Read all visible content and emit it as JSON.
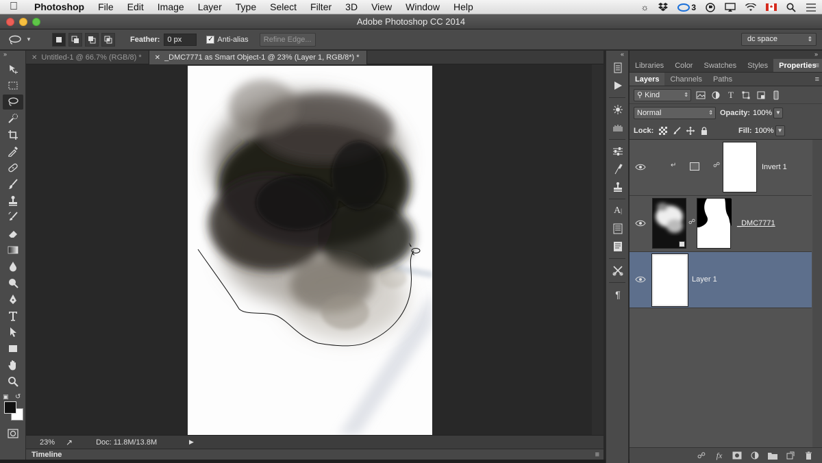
{
  "mac_menubar": {
    "app_name": "Photoshop",
    "items": [
      "File",
      "Edit",
      "Image",
      "Layer",
      "Type",
      "Select",
      "Filter",
      "3D",
      "View",
      "Window",
      "Help"
    ],
    "status_badge": "3",
    "icons": [
      "brightness-icon",
      "dropbox-icon",
      "creative-cloud-icon",
      "vpn-icon",
      "airplay-icon",
      "wifi-icon",
      "flag-canada-icon",
      "spotlight-search-icon",
      "notifications-icon"
    ]
  },
  "window": {
    "title": "Adobe Photoshop CC 2014"
  },
  "options_bar": {
    "feather_label": "Feather:",
    "feather_value": "0 px",
    "antialias_label": "Anti-alias",
    "antialias_checked": true,
    "refine_edge_label": "Refine Edge...",
    "workspace_value": "dc space"
  },
  "document_tabs": [
    {
      "label": "Untitled-1 @ 66.7% (RGB/8) *",
      "active": false
    },
    {
      "label": "_DMC7771 as Smart Object-1 @ 23% (Layer 1, RGB/8*) *",
      "active": true
    }
  ],
  "status_bar": {
    "zoom": "23%",
    "doc_info": "Doc: 11.8M/13.8M"
  },
  "timeline": {
    "label": "Timeline"
  },
  "panels": {
    "top_tabs": [
      {
        "label": "Libraries",
        "active": false
      },
      {
        "label": "Color",
        "active": false
      },
      {
        "label": "Swatches",
        "active": false
      },
      {
        "label": "Styles",
        "active": false
      },
      {
        "label": "Properties",
        "active": true
      }
    ],
    "layers_tabs": [
      {
        "label": "Layers",
        "active": true
      },
      {
        "label": "Channels",
        "active": false
      },
      {
        "label": "Paths",
        "active": false
      }
    ],
    "filter_kind": "Kind",
    "blend_mode": "Normal",
    "opacity_label": "Opacity:",
    "opacity_value": "100%",
    "lock_label": "Lock:",
    "fill_label": "Fill:",
    "fill_value": "100%"
  },
  "layers": [
    {
      "name": "Invert 1",
      "type": "adjustment",
      "visible": true,
      "selected": false
    },
    {
      "name": "_DMC7771",
      "type": "smart-object-with-mask",
      "visible": true,
      "selected": false
    },
    {
      "name": "Layer 1",
      "type": "pixel",
      "visible": true,
      "selected": true
    }
  ],
  "colors": {
    "accent_selected_layer": "#5d6f8c",
    "foreground": "#111111",
    "background": "#ffffff"
  }
}
